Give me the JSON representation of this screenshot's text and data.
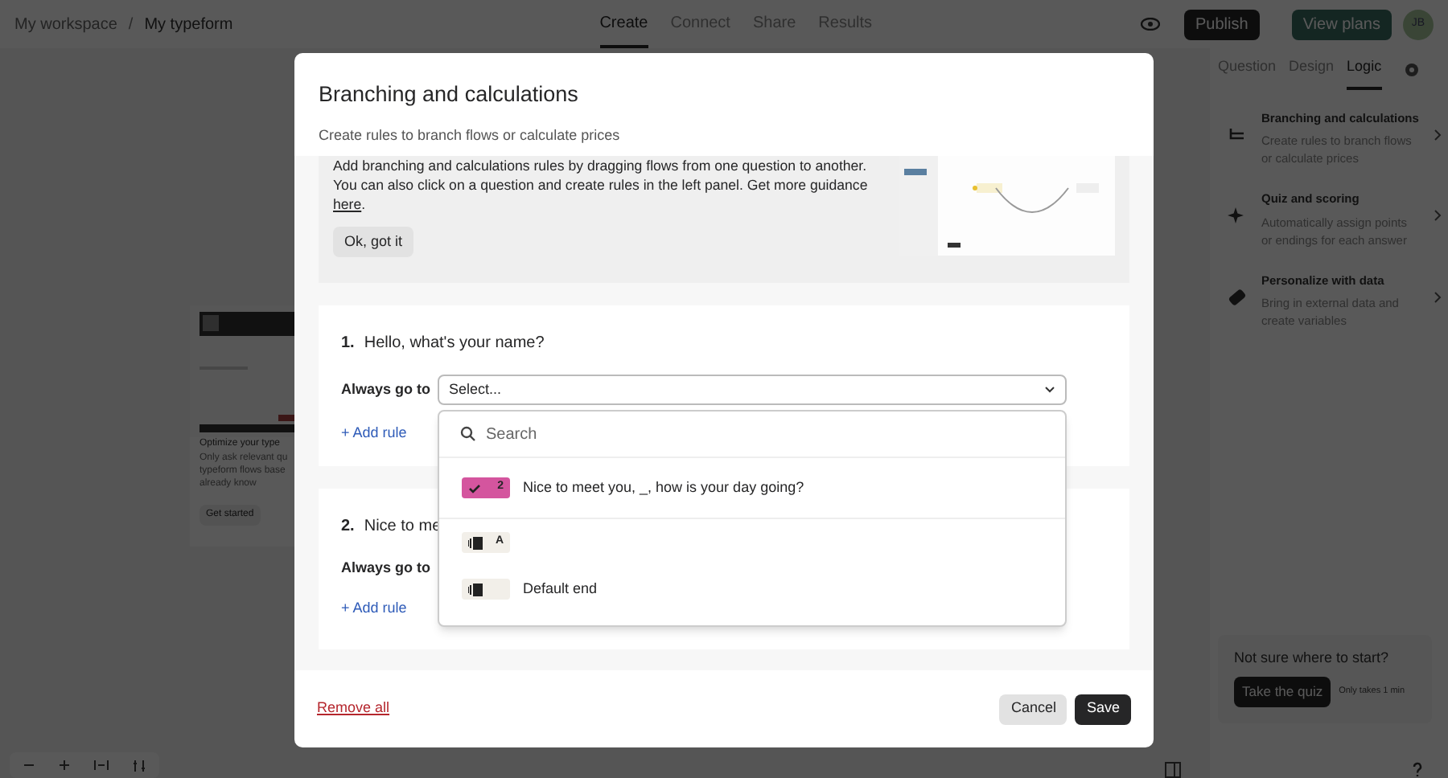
{
  "breadcrumb": [
    "My workspace",
    "My typeform"
  ],
  "breadcrumb_separator": "/",
  "nav_tabs": [
    {
      "label": "Create",
      "selected": true
    },
    {
      "label": "Connect",
      "selected": false
    },
    {
      "label": "Share",
      "selected": false
    },
    {
      "label": "Results",
      "selected": false
    }
  ],
  "top_buttons": {
    "publish": "Publish",
    "plans": "View plans",
    "avatar": "JB"
  },
  "panel_tabs": [
    {
      "label": "Question",
      "selected": false
    },
    {
      "label": "Design",
      "selected": false
    },
    {
      "label": "Logic",
      "selected": true
    }
  ],
  "logic_items": [
    {
      "kind": "branch",
      "title": "Branching and calculations",
      "text": "Create rules to branch flows or calculate prices"
    },
    {
      "kind": "quiz",
      "title": "Quiz and scoring",
      "text": "Automatically assign points or endings for each answer"
    },
    {
      "kind": "data",
      "title": "Personalize with data",
      "text": "Bring in external data and create variables"
    }
  ],
  "promo_card": {
    "title": "Optimize your type",
    "lines": [
      "Only ask relevant qu",
      "typeform flows base",
      "already know"
    ],
    "button": "Get started"
  },
  "quiz_box": {
    "text": "Not sure where to start?",
    "button": "Take the quiz",
    "note": "Only takes 1 min"
  },
  "modal": {
    "title": "Branching and calculations",
    "subtitle": "Create rules to branch flows or calculate prices",
    "info": {
      "text": "Add branching and calculations rules by dragging flows from one question to another. You can also click on a question and create rules in the left panel. Get more guidance ",
      "link": "here",
      "end": ".",
      "button": "Ok, got it"
    },
    "questions": [
      {
        "number": "1.",
        "title": "Hello, what's your name?",
        "label": "Always go to",
        "select": "Select...",
        "add": "+ Add rule"
      },
      {
        "number": "2.",
        "title": "Nice to me",
        "label": "Always go to",
        "add": "+ Add rule"
      }
    ],
    "dropdown": {
      "placeholder": "Search",
      "options": [
        {
          "kind": "question",
          "badge": "2",
          "text": "Nice to meet you, _, how is your day going?",
          "color": "#d4559e",
          "selected": true
        },
        {
          "kind": "ending",
          "badge": "A",
          "selected": false
        },
        {
          "kind": "ending",
          "text": "Default end",
          "selected": false
        }
      ]
    },
    "remove": "Remove all",
    "cancel": "Cancel",
    "save": "Save"
  }
}
